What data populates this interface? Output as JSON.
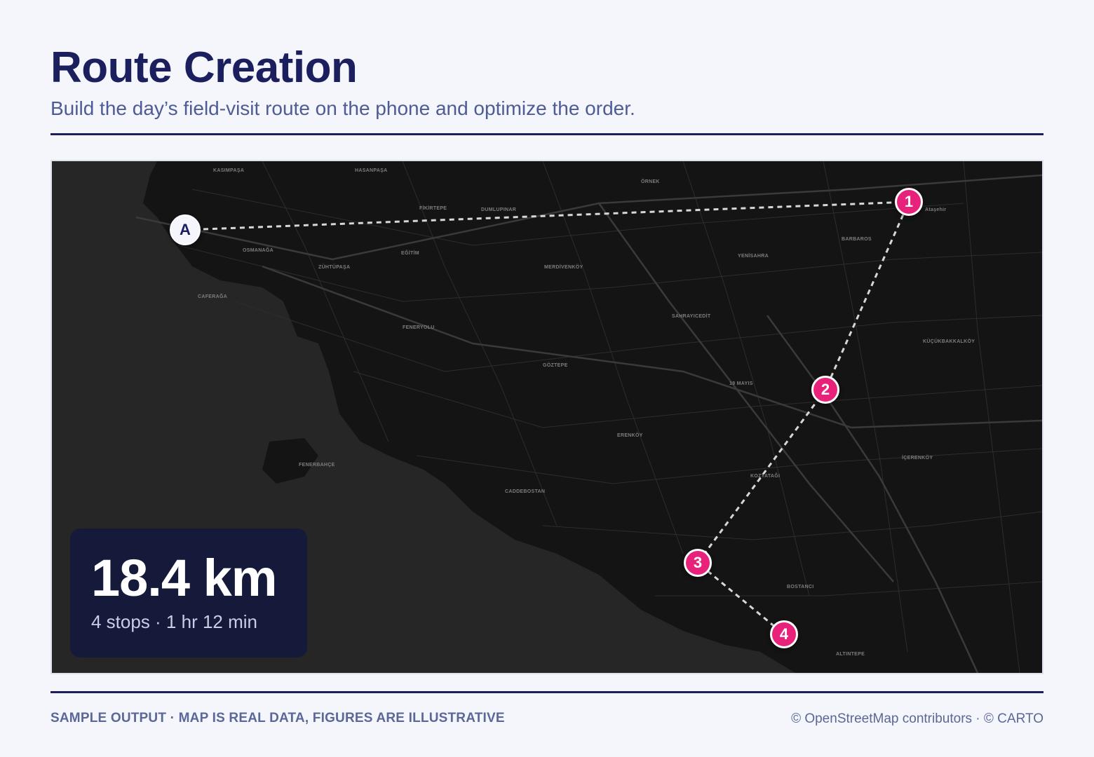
{
  "header": {
    "title": "Route Creation",
    "subtitle": "Build the day’s field-visit route on the phone and optimize the order."
  },
  "map": {
    "place_labels": [
      "KASIMPAŞA",
      "HASANPAŞA",
      "ÖRNEK",
      "Ataşehir",
      "FİKİRTEPE",
      "DUMLUPINAR",
      "BARBAROS",
      "OSMANAĞA",
      "EĞİTİM",
      "YENİSAHRA",
      "ZÜHTÜPAŞA",
      "MERDİVENKÖY",
      "CAFERAĞA",
      "SAHRAYICEDİT",
      "FENERYOLU",
      "KÜÇÜKBAKKALKÖY",
      "GÖZTEPE",
      "19 MAYIS",
      "ERENKÖY",
      "İÇERENKÖY",
      "FENERBAHÇE",
      "KOZYATAĞI",
      "CADDEBOSTAN",
      "BOSTANCI",
      "ALTINTEPE"
    ],
    "route_color": "#e8217a",
    "start": {
      "label": "A"
    },
    "stops": [
      {
        "label": "1"
      },
      {
        "label": "2"
      },
      {
        "label": "3"
      },
      {
        "label": "4"
      }
    ]
  },
  "summary": {
    "distance": "18.4 km",
    "meta": "4 stops · 1 hr 12 min"
  },
  "footer": {
    "disclaimer": "SAMPLE OUTPUT · MAP IS REAL DATA, FIGURES ARE ILLUSTRATIVE",
    "attribution": "© OpenStreetMap contributors · © CARTO"
  }
}
